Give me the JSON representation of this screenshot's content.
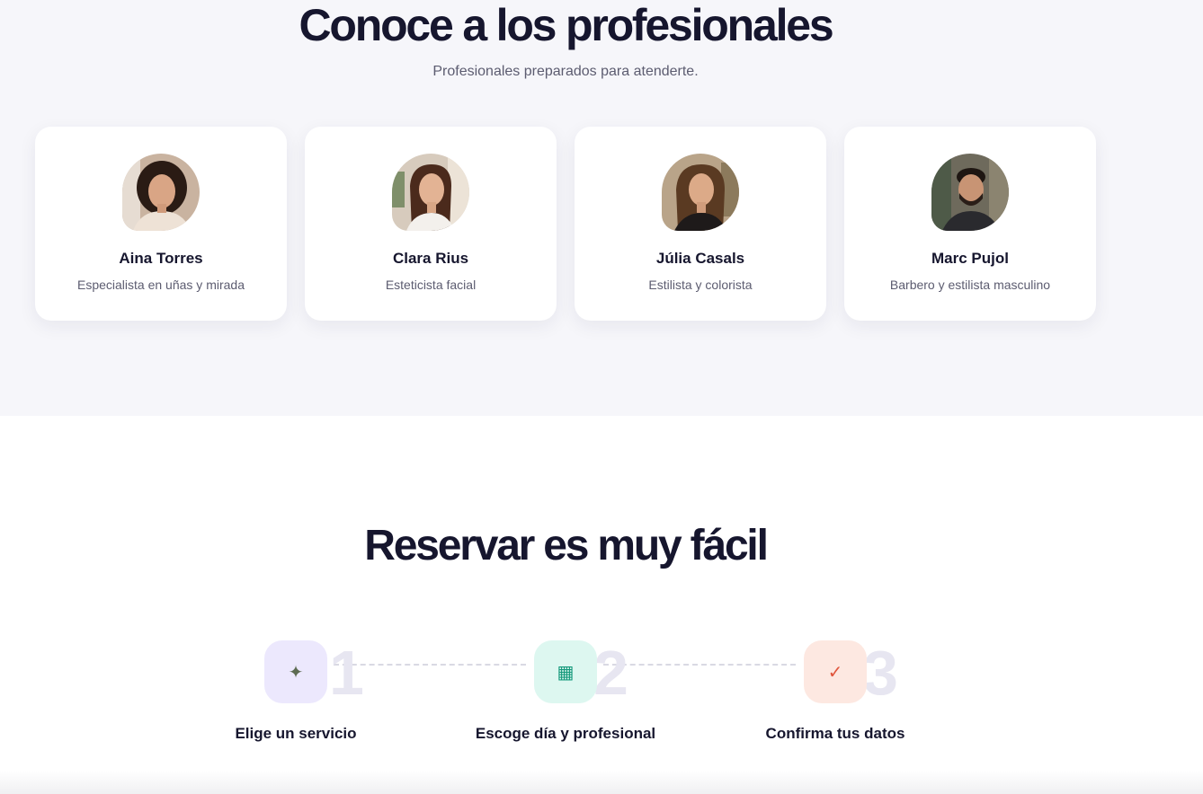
{
  "pros": {
    "title": "Conoce a los profesionales",
    "subtitle": "Profesionales preparados para atenderte.",
    "cards": [
      {
        "name": "Aina Torres",
        "role": "Especialista en uñas y mirada"
      },
      {
        "name": "Clara Rius",
        "role": "Esteticista facial"
      },
      {
        "name": "Júlia Casals",
        "role": "Estilista y colorista"
      },
      {
        "name": "Marc Pujol",
        "role": "Barbero y estilista masculino"
      }
    ]
  },
  "steps": {
    "title": "Reservar es muy fácil",
    "items": [
      {
        "number": "1",
        "label": "Elige un servicio",
        "icon": "✦",
        "icon_name": "sparkle-icon",
        "icon_bg": "#ece8fd",
        "icon_color": "#5d6b52"
      },
      {
        "number": "2",
        "label": "Escoge día y profesional",
        "icon": "▦",
        "icon_name": "calendar-icon",
        "icon_bg": "#ddf7f0",
        "icon_color": "#14997b"
      },
      {
        "number": "3",
        "label": "Confirma tus datos",
        "icon": "✓",
        "icon_name": "check-icon",
        "icon_bg": "#fde8e1",
        "icon_color": "#e0553c"
      }
    ]
  }
}
